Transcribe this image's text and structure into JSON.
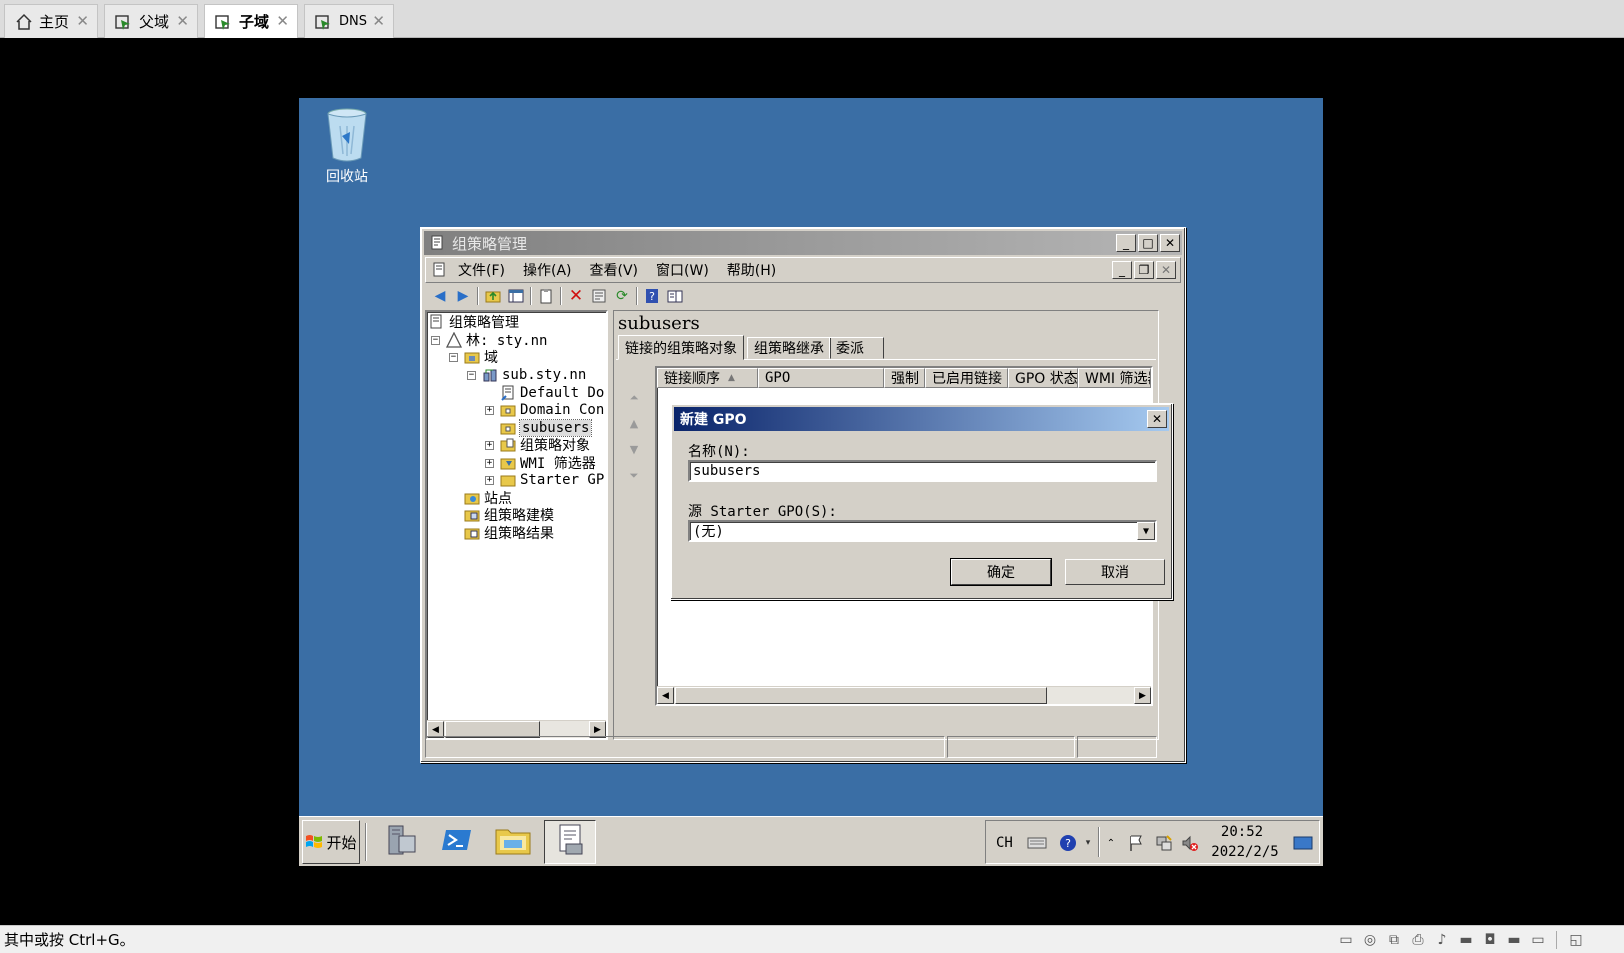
{
  "host_tabs": [
    {
      "label": "主页",
      "icon": "home-icon",
      "active": false
    },
    {
      "label": "父域",
      "icon": "vm-icon",
      "active": false
    },
    {
      "label": "子域",
      "icon": "vm-icon",
      "active": true
    },
    {
      "label": "DNS",
      "icon": "vm-icon",
      "active": false
    }
  ],
  "desktop": {
    "recycle_bin_label": "回收站"
  },
  "gpm_window": {
    "title": "组策略管理",
    "menu": [
      "文件(F)",
      "操作(A)",
      "查看(V)",
      "窗口(W)",
      "帮助(H)"
    ],
    "tree": {
      "root": "组策略管理",
      "forest": "林: sty.nn",
      "domains": "域",
      "domain": "sub.sty.nn",
      "default_policy": "Default Dor",
      "domain_controllers": "Domain Con",
      "subusers": "subusers",
      "gpo_objects": "组策略对象",
      "wmi_filters": "WMI 筛选器",
      "starter_gpo": "Starter GP(",
      "sites": "站点",
      "modeling": "组策略建模",
      "results": "组策略结果"
    },
    "pane_title": "subusers",
    "tabs": [
      "链接的组策略对象",
      "组策略继承",
      "委派"
    ],
    "columns": [
      "链接顺序",
      "GPO",
      "强制",
      "已启用链接",
      "GPO 状态",
      "WMI 筛选器"
    ]
  },
  "dialog": {
    "title": "新建 GPO",
    "name_label": "名称(N):",
    "name_value": "subusers",
    "source_label": "源 Starter GPO(S):",
    "source_value": "(无)",
    "ok": "确定",
    "cancel": "取消"
  },
  "taskbar": {
    "start": "开始",
    "lang": "CH",
    "time": "20:52",
    "date": "2022/2/5"
  },
  "host_status": {
    "hint": "其中或按 Ctrl+G。"
  },
  "colors": {
    "desktop": "#3a6ea5",
    "dialog_title": "#0a246a",
    "face": "#d4d0c8"
  }
}
